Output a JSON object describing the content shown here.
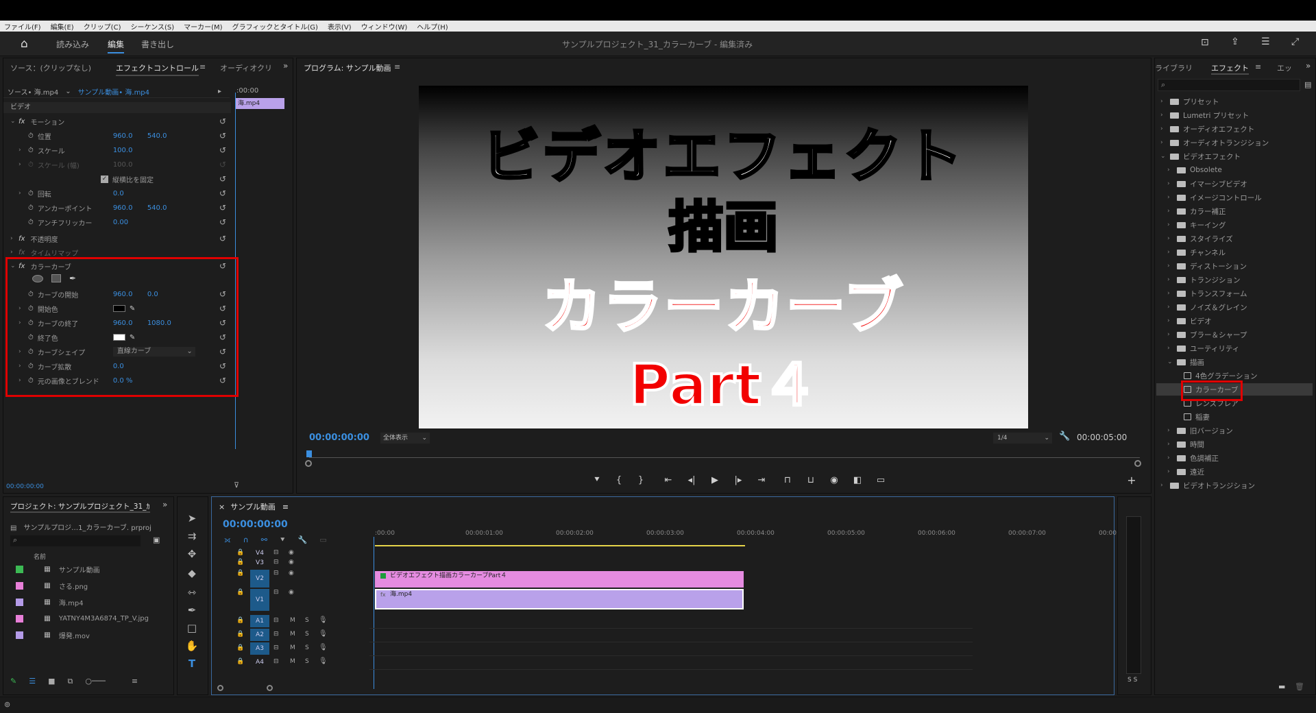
{
  "menu": [
    "ファイル(F)",
    "編集(E)",
    "クリップ(C)",
    "シーケンス(S)",
    "マーカー(M)",
    "グラフィックとタイトル(G)",
    "表示(V)",
    "ウィンドウ(W)",
    "ヘルプ(H)"
  ],
  "header": {
    "workspaces": [
      "読み込み",
      "編集",
      "書き出し"
    ],
    "active_workspace": "編集",
    "project_title": "サンプルプロジェクト_31_カラーカーブ",
    "status": " - 編集済み"
  },
  "effect_controls": {
    "tabs": [
      "ソース：(クリップなし)",
      "エフェクトコントロール",
      "オーディオクリ"
    ],
    "source_clip": "ソース• 海.mp4",
    "sequence_clip": "サンプル動画• 海.mp4",
    "timecode_start": ":00:00",
    "clip_label": "海.mp4",
    "section_video": "ビデオ",
    "motion": {
      "name": "モーション",
      "params": [
        {
          "label": "位置",
          "v1": "960.0",
          "v2": "540.0"
        },
        {
          "label": "スケール",
          "v1": "100.0",
          "v2": ""
        },
        {
          "label": "スケール (幅)",
          "v1": "100.0",
          "v2": ""
        },
        {
          "label": "縦横比を固定",
          "v1": "",
          "v2": ""
        },
        {
          "label": "回転",
          "v1": "0.0",
          "v2": ""
        },
        {
          "label": "アンカーポイント",
          "v1": "960.0",
          "v2": "540.0"
        },
        {
          "label": "アンチフリッカー",
          "v1": "0.00",
          "v2": ""
        }
      ]
    },
    "opacity": "不透明度",
    "timeremap": "タイムリマップ",
    "colorcurve": {
      "name": "カラーカーブ",
      "params": [
        {
          "label": "カーブの開始",
          "v1": "960.0",
          "v2": "0.0"
        },
        {
          "label": "開始色",
          "v1": "",
          "v2": ""
        },
        {
          "label": "カーブの終了",
          "v1": "960.0",
          "v2": "1080.0"
        },
        {
          "label": "終了色",
          "v1": "",
          "v2": ""
        },
        {
          "label": "カーブシェイプ",
          "v1": "直線カーブ",
          "v2": ""
        },
        {
          "label": "カーブ拡散",
          "v1": "0.0",
          "v2": ""
        },
        {
          "label": "元の画像とブレンド",
          "v1": "0.0 %",
          "v2": ""
        }
      ]
    },
    "bottom_timecode": "00:00:00:00"
  },
  "program": {
    "title": "プログラム: サンプル動画",
    "overlay": {
      "line1": "ビデオエフェクト",
      "line2": "描画",
      "line3": "カラーカーブ",
      "line4": "Part４"
    },
    "timecode": "00:00:00:00",
    "fit": "全体表示",
    "quality": "1/4",
    "duration": "00:00:05:00"
  },
  "effects_panel": {
    "tabs": [
      "ライブラリ",
      "エフェクト",
      "エッ"
    ],
    "tree": [
      {
        "label": "プリセット",
        "level": 0,
        "icon": "folder"
      },
      {
        "label": "Lumetri プリセット",
        "level": 0,
        "icon": "folder"
      },
      {
        "label": "オーディオエフェクト",
        "level": 0,
        "icon": "folder"
      },
      {
        "label": "オーディオトランジション",
        "level": 0,
        "icon": "folder"
      },
      {
        "label": "ビデオエフェクト",
        "level": 0,
        "icon": "folder",
        "open": true
      },
      {
        "label": "Obsolete",
        "level": 1,
        "icon": "folder"
      },
      {
        "label": "イマーシブビデオ",
        "level": 1,
        "icon": "folder"
      },
      {
        "label": "イメージコントロール",
        "level": 1,
        "icon": "folder"
      },
      {
        "label": "カラー補正",
        "level": 1,
        "icon": "folder"
      },
      {
        "label": "キーイング",
        "level": 1,
        "icon": "folder"
      },
      {
        "label": "スタイライズ",
        "level": 1,
        "icon": "folder"
      },
      {
        "label": "チャンネル",
        "level": 1,
        "icon": "folder"
      },
      {
        "label": "ディストーション",
        "level": 1,
        "icon": "folder"
      },
      {
        "label": "トランジション",
        "level": 1,
        "icon": "folder"
      },
      {
        "label": "トランスフォーム",
        "level": 1,
        "icon": "folder"
      },
      {
        "label": "ノイズ＆グレイン",
        "level": 1,
        "icon": "folder"
      },
      {
        "label": "ビデオ",
        "level": 1,
        "icon": "folder"
      },
      {
        "label": "ブラー＆シャープ",
        "level": 1,
        "icon": "folder"
      },
      {
        "label": "ユーティリティ",
        "level": 1,
        "icon": "folder"
      },
      {
        "label": "描画",
        "level": 1,
        "icon": "folder",
        "open": true
      },
      {
        "label": "4色グラデーション",
        "level": 2,
        "icon": "effect"
      },
      {
        "label": "カラーカーブ",
        "level": 2,
        "icon": "effect",
        "selected": true
      },
      {
        "label": "レンズフレア",
        "level": 2,
        "icon": "effect"
      },
      {
        "label": "稲妻",
        "level": 2,
        "icon": "effect"
      },
      {
        "label": "旧バージョン",
        "level": 1,
        "icon": "folder"
      },
      {
        "label": "時間",
        "level": 1,
        "icon": "folder"
      },
      {
        "label": "色調補正",
        "level": 1,
        "icon": "folder"
      },
      {
        "label": "遠近",
        "level": 1,
        "icon": "folder"
      },
      {
        "label": "ビデオトランジション",
        "level": 0,
        "icon": "folder"
      }
    ]
  },
  "project": {
    "title": "プロジェクト: サンプルプロジェクト_31_ｶ",
    "file": "サンプルプロジ…1_カラーカーブ. prproj",
    "col_name": "名前",
    "items": [
      {
        "name": "サンプル動画",
        "color": "#3cba54"
      },
      {
        "name": "さる.png",
        "color": "#e87fd8"
      },
      {
        "name": "海.mp4",
        "color": "#b49be8"
      },
      {
        "name": "YATNY4M3A6874_TP_V.jpg",
        "color": "#e87fd8"
      },
      {
        "name": "爆発.mov",
        "color": "#b49be8"
      }
    ]
  },
  "timeline": {
    "tab": "サンプル動画",
    "timecode": "00:00:00:00",
    "ruler": [
      ":00:00",
      "00:00:01:00",
      "00:00:02:00",
      "00:00:03:00",
      "00:00:04:00",
      "00:00:05:00",
      "00:00:06:00",
      "00:00:07:00",
      "00:00:"
    ],
    "video_tracks": [
      "V4",
      "V3",
      "V2",
      "V1"
    ],
    "audio_tracks": [
      "A1",
      "A2",
      "A3",
      "A4"
    ],
    "clip_graphic": "ビデオエフェクト描画カラーカーブPart４",
    "clip_video": "海.mp4",
    "track_m": "M",
    "track_s": "S"
  },
  "meter": {
    "labels": "S S"
  },
  "colors": {
    "highlight": "#e00000",
    "accent": "#3b8fe0",
    "graphic_clip": "#e58be0",
    "video_clip": "#b9a1ea"
  }
}
